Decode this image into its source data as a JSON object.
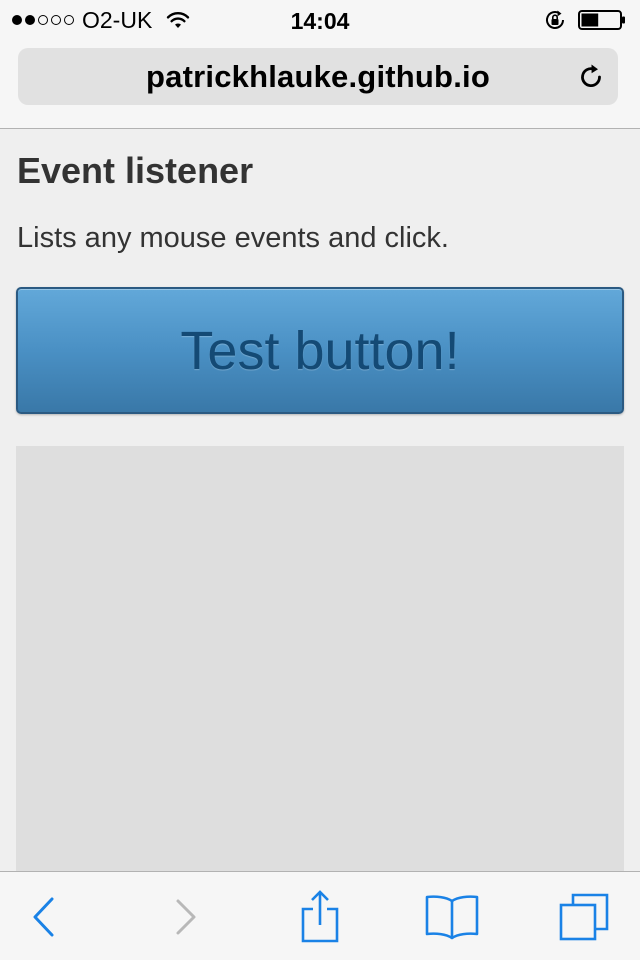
{
  "status_bar": {
    "carrier": "O2-UK",
    "time": "14:04",
    "signal_bars_filled": 2,
    "signal_bars_total": 5,
    "battery_level": 0.45
  },
  "browser": {
    "url": "patrickhlauke.github.io"
  },
  "page": {
    "heading": "Event listener",
    "description": "Lists any mouse events and click.",
    "button_label": "Test button!"
  },
  "toolbar": {
    "icons": [
      "back-icon",
      "forward-icon",
      "share-icon",
      "bookmarks-icon",
      "tabs-icon"
    ],
    "accent_color": "#1a82e6",
    "disabled_color": "#b8b8b8"
  },
  "colors": {
    "button_top": "#62a8d9",
    "button_bottom": "#3978a8",
    "button_text": "#144a75",
    "log_background": "#dedede",
    "page_background": "#efefef"
  }
}
